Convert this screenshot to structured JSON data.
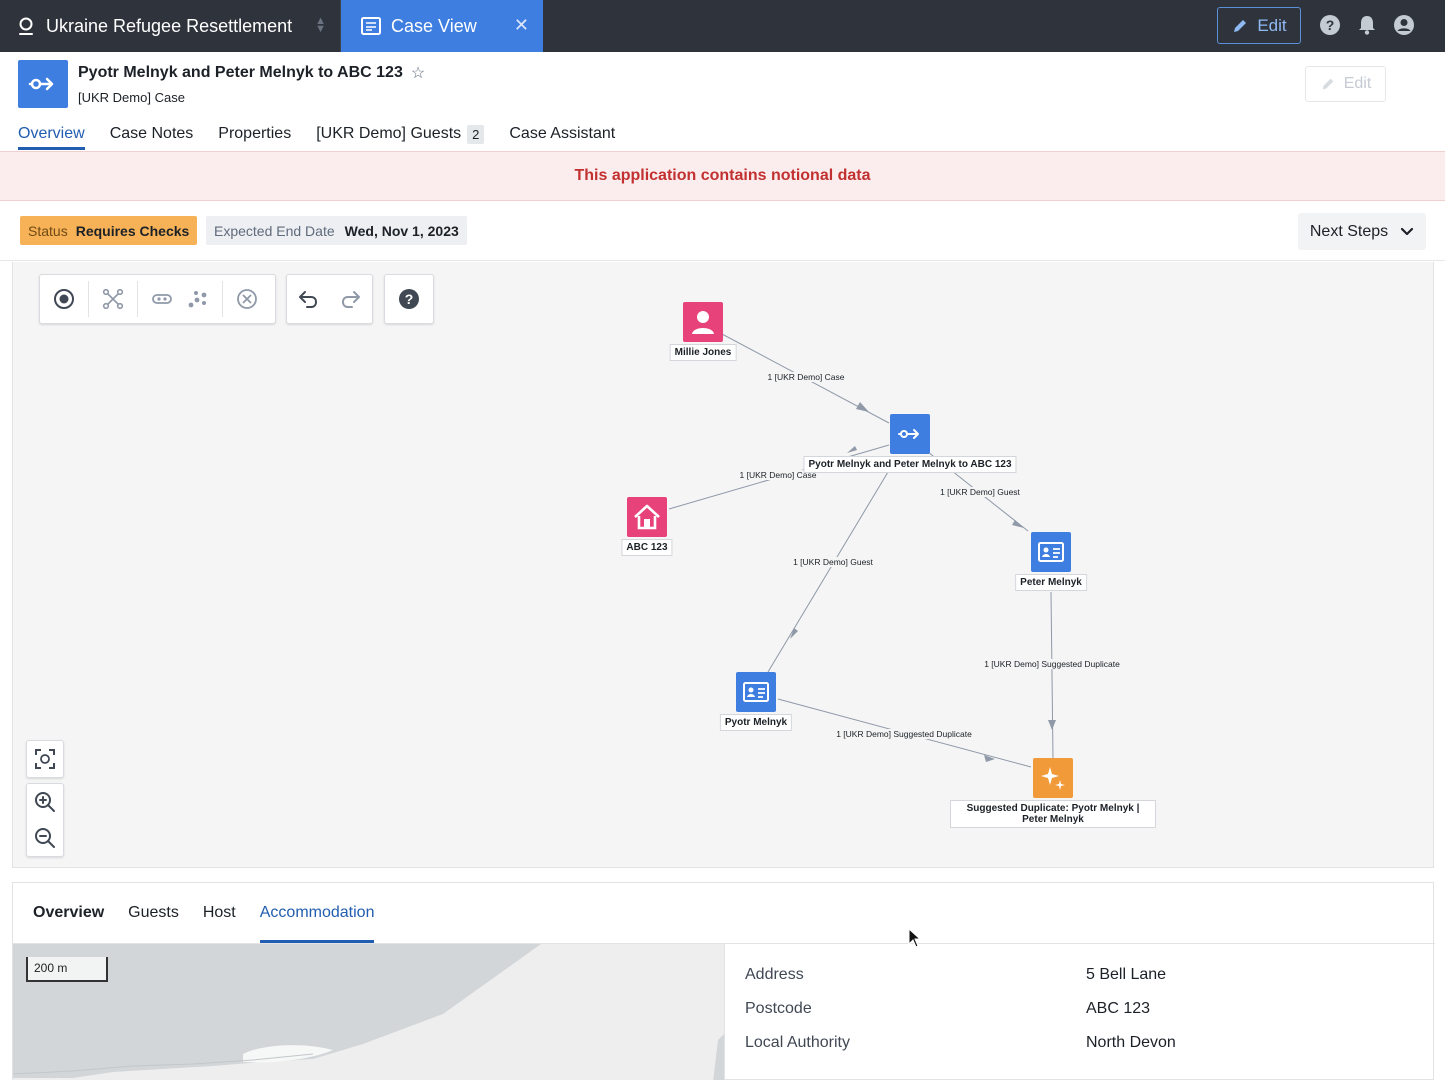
{
  "app": {
    "title": "Ukraine Refugee Resettlement",
    "active_tab": "Case View",
    "edit_label": "Edit"
  },
  "header": {
    "title": "Pyotr Melnyk and Peter Melnyk to ABC 123",
    "subtitle": "[UKR Demo] Case",
    "edit_label": "Edit"
  },
  "tabs": [
    {
      "label": "Overview"
    },
    {
      "label": "Case Notes"
    },
    {
      "label": "Properties"
    },
    {
      "label": "[UKR Demo] Guests",
      "count": "2"
    },
    {
      "label": "Case Assistant"
    }
  ],
  "banner": "This application contains notional data",
  "status": {
    "status_key": "Status",
    "status_value": "Requires Checks",
    "date_key": "Expected End Date",
    "date_value": "Wed, Nov 1, 2023",
    "next_steps": "Next Steps"
  },
  "graph": {
    "nodes": {
      "millie": "Millie Jones",
      "case": "Pyotr Melnyk and Peter Melnyk to ABC 123",
      "abc": "ABC 123",
      "peter": "Peter Melnyk",
      "pyotr": "Pyotr Melnyk",
      "dup": "Suggested Duplicate: Pyotr Melnyk | Peter Melnyk"
    },
    "edges": {
      "millie_case": "1 [UKR Demo] Case",
      "abc_case": "1 [UKR Demo] Case",
      "case_peter": "1 [UKR Demo] Guest",
      "case_pyotr": "1 [UKR Demo] Guest",
      "peter_dup": "1 [UKR Demo] Suggested Duplicate",
      "pyotr_dup": "1 [UKR Demo] Suggested Duplicate"
    },
    "colors": {
      "person": "#e7427a",
      "case": "#3e7ee0",
      "duplicate": "#f09a3a"
    }
  },
  "bottom": {
    "tabs": [
      {
        "label": "Overview"
      },
      {
        "label": "Guests"
      },
      {
        "label": "Host"
      },
      {
        "label": "Accommodation"
      }
    ],
    "map_scale": "200 m",
    "properties": [
      {
        "key": "Address",
        "value": "5 Bell Lane"
      },
      {
        "key": "Postcode",
        "value": "ABC 123"
      },
      {
        "key": "Local Authority",
        "value": "North Devon"
      }
    ]
  }
}
